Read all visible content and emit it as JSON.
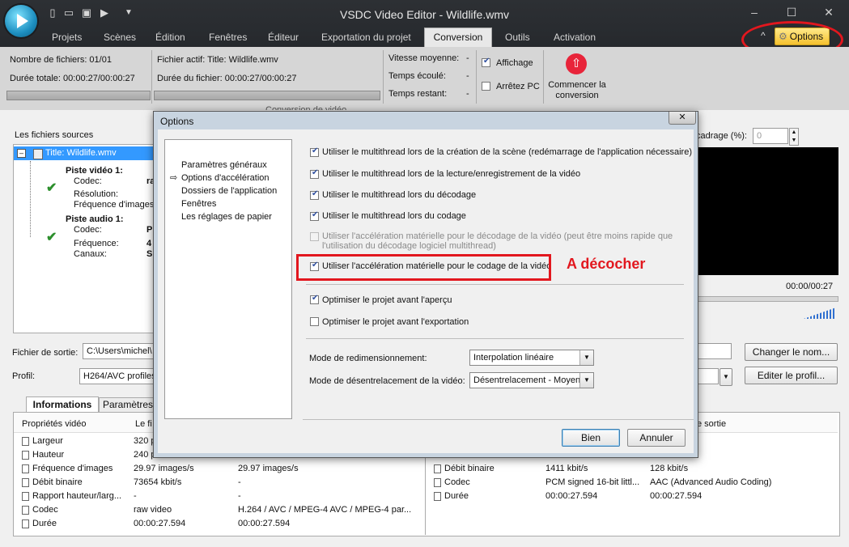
{
  "app": {
    "title": "VSDC Video Editor - Wildlife.wmv",
    "menu_tabs": [
      "Projets",
      "Scènes",
      "Édition",
      "Fenêtres",
      "Éditeur",
      "Exportation du projet",
      "Conversion",
      "Outils",
      "Activation"
    ],
    "active_tab": "Conversion",
    "options_label": "Options"
  },
  "ribbon": {
    "files_count": "Nombre de fichiers: 01/01",
    "total_duration": "Durée totale: 00:00:27/00:00:27",
    "active_file": "Fichier actif: Title: Wildlife.wmv",
    "file_duration": "Durée du fichier: 00:00:27/00:00:27",
    "avg_speed_label": "Vitesse moyenne:",
    "avg_speed_value": "-",
    "elapsed_label": "Temps écoulé:",
    "elapsed_value": "-",
    "remaining_label": "Temps restant:",
    "remaining_value": "-",
    "display_label": "Affichage",
    "display_checked": true,
    "shutdown_label": "Arrêtez PC",
    "shutdown_checked": false,
    "start_label_1": "Commencer la",
    "start_label_2": "conversion",
    "group_caption": "Conversion de vidéo"
  },
  "sources": {
    "header": "Les fichiers sources",
    "title": "Title: Wildlife.wmv",
    "video_track": "Piste vidéo 1:",
    "codec_label": "Codec:",
    "codec_value": "ra",
    "resolution_label": "Résolution:",
    "framerate_label": "Fréquence d'images:",
    "audio_track": "Piste audio 1:",
    "a_codec_label": "Codec:",
    "a_codec_value": "P",
    "a_freq_label": "Fréquence:",
    "a_freq_value": "4",
    "a_channels_label": "Canaux:",
    "a_channels_value": "S"
  },
  "preview": {
    "crop_label": "cadrage (%):",
    "crop_value": "0",
    "time": "00:00/00:27"
  },
  "output": {
    "file_label": "Fichier de sortie:",
    "file_value": "C:\\Users\\michel\\",
    "profile_label": "Profil:",
    "profile_value": "H264/AVC profiles",
    "rename_label": "Changer le nom...",
    "edit_profile_label": "Editer le profil..."
  },
  "info": {
    "tab_info": "Informations",
    "tab_params": "Paramètres s",
    "col_props": "Propriétés vidéo",
    "col_file": "Le fi",
    "col_out": "e sortie",
    "video_rows": [
      {
        "name": "Largeur",
        "src": "320 p",
        "dst": ""
      },
      {
        "name": "Hauteur",
        "src": "240 p",
        "dst": ""
      },
      {
        "name": "Fréquence d'images",
        "src": "29.97 images/s",
        "dst": "29.97 images/s"
      },
      {
        "name": "Débit binaire",
        "src": "73654 kbit/s",
        "dst": "-"
      },
      {
        "name": "Rapport hauteur/larg...",
        "src": "-",
        "dst": "-"
      },
      {
        "name": "Codec",
        "src": "raw video",
        "dst": "H.264 / AVC / MPEG-4 AVC / MPEG-4 par..."
      },
      {
        "name": "Durée",
        "src": "00:00:27.594",
        "dst": "00:00:27.594"
      }
    ],
    "audio_rows": [
      {
        "name": "Débit binaire",
        "src": "1411 kbit/s",
        "dst": "128 kbit/s"
      },
      {
        "name": "Codec",
        "src": "PCM signed 16-bit littl...",
        "dst": "AAC (Advanced Audio Coding)"
      },
      {
        "name": "Durée",
        "src": "00:00:27.594",
        "dst": "00:00:27.594"
      }
    ]
  },
  "dialog": {
    "title": "Options",
    "close": "✕",
    "nav": [
      "Paramètres généraux",
      "Options d'accélération",
      "Dossiers de l'application",
      "Fenêtres",
      "Les réglages de papier"
    ],
    "nav_selected": 1,
    "options": [
      {
        "label": "Utiliser le multithread lors de la création de la scène (redémarrage de l'application nécessaire)",
        "checked": true,
        "disabled": false
      },
      {
        "label": "Utiliser le multithread lors de la lecture/enregistrement de la vidéo",
        "checked": true,
        "disabled": false
      },
      {
        "label": "Utiliser le multithread lors du décodage",
        "checked": true,
        "disabled": false
      },
      {
        "label": "Utiliser le multithread lors du codage",
        "checked": true,
        "disabled": false
      },
      {
        "label": "Utiliser l'accélération matérielle pour le décodage de la vidéo (peut être moins rapide que",
        "label2": "l'utilisation du décodage logiciel multithread)",
        "checked": false,
        "disabled": true
      },
      {
        "label": "Utiliser l'accélération matérielle pour le codage de la vidéo",
        "checked": true,
        "disabled": false
      }
    ],
    "optimize_preview": {
      "label": "Optimiser le projet avant l'aperçu",
      "checked": true
    },
    "optimize_export": {
      "label": "Optimiser le projet avant l'exportation",
      "checked": false
    },
    "resize_label": "Mode de redimensionnement:",
    "resize_value": "Interpolation linéaire",
    "deinterlace_label": "Mode de désentrelacement de la vidéo:",
    "deinterlace_value": "Désentrelacement - Moyen",
    "ok_label": "Bien",
    "cancel_label": "Annuler"
  },
  "annotation": {
    "text": "A décocher",
    "color": "#e2171e"
  }
}
